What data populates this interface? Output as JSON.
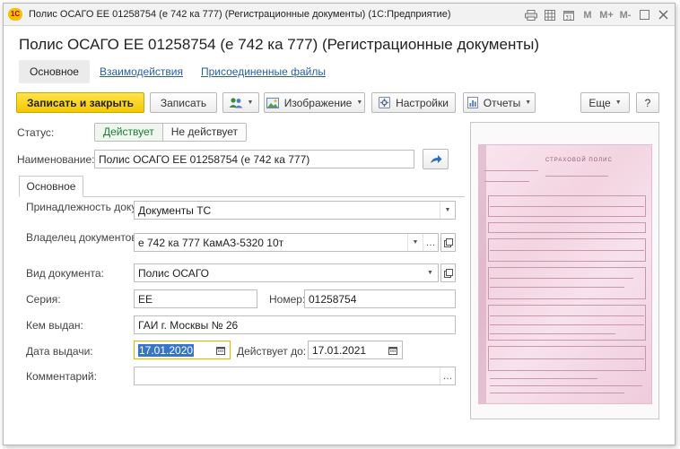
{
  "window": {
    "logo": "1С",
    "title": "Полис ОСАГО ЕЕ 01258754 (е 742 ка 777) (Регистрационные документы)  (1С:Предприятие)",
    "tools": {
      "m": "M",
      "mplus": "M+",
      "mminus": "M-"
    }
  },
  "form": {
    "heading": "Полис ОСАГО ЕЕ 01258754 (е 742 ка 777) (Регистрационные документы)"
  },
  "nav_tabs": [
    "Основное",
    "Взаимодействия",
    "Присоединенные файлы"
  ],
  "toolbar": {
    "save_close": "Записать и закрыть",
    "save": "Записать",
    "image": "Изображение",
    "settings": "Настройки",
    "reports": "Отчеты",
    "more": "Еще",
    "help": "?"
  },
  "status": {
    "label": "Статус:",
    "options": [
      "Действует",
      "Не действует"
    ],
    "selected": "Действует"
  },
  "name_field": {
    "label": "Наименование:",
    "value": "Полис ОСАГО ЕЕ 01258754 (е 742 ка 777)"
  },
  "inner_tab": "Основное",
  "fields": {
    "belonging": {
      "label": "Принадлежность документов:",
      "value": "Документы ТС"
    },
    "owner": {
      "label": "Владелец документов:",
      "value": "е 742 ка 777 КамАЗ-5320 10т"
    },
    "doc_type": {
      "label": "Вид документа:",
      "value": "Полис ОСАГО"
    },
    "series": {
      "label": "Серия:",
      "value": "ЕЕ"
    },
    "number": {
      "label": "Номер:",
      "value": "01258754"
    },
    "issued_by": {
      "label": "Кем выдан:",
      "value": "ГАИ г. Москвы № 26"
    },
    "issue_date": {
      "label": "Дата выдачи:",
      "value": "17.01.2020"
    },
    "valid_until": {
      "label": "Действует до:",
      "value": "17.01.2021"
    },
    "comment": {
      "label": "Комментарий:",
      "value": ""
    }
  },
  "scan": {
    "title": "СТРАХОВОЙ ПОЛИС"
  },
  "colors": {
    "accent_yellow": "#f4c800",
    "link_blue": "#2a5cab",
    "status_green": "#1c7a3c",
    "selection_blue": "#3875c6"
  },
  "icons": [
    "app-logo-icon",
    "print-icon",
    "table-icon",
    "calendar-icon",
    "restore-icon",
    "close-icon",
    "users-icon",
    "image-icon",
    "settings-icon",
    "reports-icon",
    "goto-arrow-icon",
    "dropdown-icon",
    "ellipsis-icon",
    "open-icon"
  ]
}
